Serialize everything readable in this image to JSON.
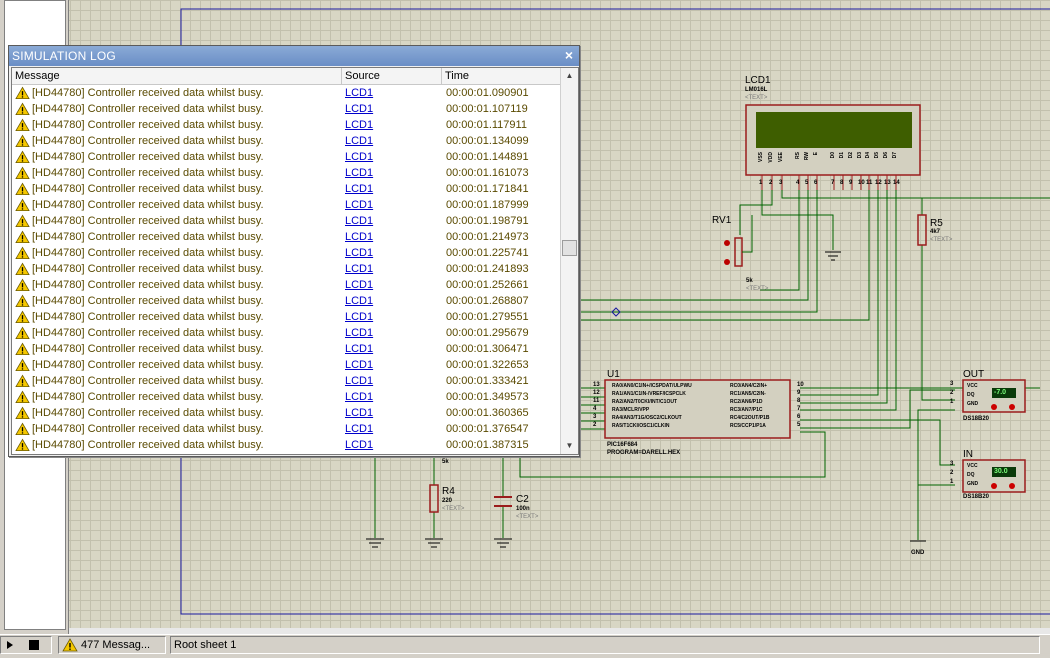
{
  "log_window": {
    "title": "SIMULATION LOG",
    "close_glyph": "×",
    "columns": {
      "message": "Message",
      "source": "Source",
      "time": "Time"
    },
    "rows": [
      {
        "message": "[HD44780] Controller received data whilst busy.",
        "source": "LCD1",
        "time": "00:00:01.090901"
      },
      {
        "message": "[HD44780] Controller received data whilst busy.",
        "source": "LCD1",
        "time": "00:00:01.107119"
      },
      {
        "message": "[HD44780] Controller received data whilst busy.",
        "source": "LCD1",
        "time": "00:00:01.117911"
      },
      {
        "message": "[HD44780] Controller received data whilst busy.",
        "source": "LCD1",
        "time": "00:00:01.134099"
      },
      {
        "message": "[HD44780] Controller received data whilst busy.",
        "source": "LCD1",
        "time": "00:00:01.144891"
      },
      {
        "message": "[HD44780] Controller received data whilst busy.",
        "source": "LCD1",
        "time": "00:00:01.161073"
      },
      {
        "message": "[HD44780] Controller received data whilst busy.",
        "source": "LCD1",
        "time": "00:00:01.171841"
      },
      {
        "message": "[HD44780] Controller received data whilst busy.",
        "source": "LCD1",
        "time": "00:00:01.187999"
      },
      {
        "message": "[HD44780] Controller received data whilst busy.",
        "source": "LCD1",
        "time": "00:00:01.198791"
      },
      {
        "message": "[HD44780] Controller received data whilst busy.",
        "source": "LCD1",
        "time": "00:00:01.214973"
      },
      {
        "message": "[HD44780] Controller received data whilst busy.",
        "source": "LCD1",
        "time": "00:00:01.225741"
      },
      {
        "message": "[HD44780] Controller received data whilst busy.",
        "source": "LCD1",
        "time": "00:00:01.241893"
      },
      {
        "message": "[HD44780] Controller received data whilst busy.",
        "source": "LCD1",
        "time": "00:00:01.252661"
      },
      {
        "message": "[HD44780] Controller received data whilst busy.",
        "source": "LCD1",
        "time": "00:00:01.268807"
      },
      {
        "message": "[HD44780] Controller received data whilst busy.",
        "source": "LCD1",
        "time": "00:00:01.279551"
      },
      {
        "message": "[HD44780] Controller received data whilst busy.",
        "source": "LCD1",
        "time": "00:00:01.295679"
      },
      {
        "message": "[HD44780] Controller received data whilst busy.",
        "source": "LCD1",
        "time": "00:00:01.306471"
      },
      {
        "message": "[HD44780] Controller received data whilst busy.",
        "source": "LCD1",
        "time": "00:00:01.322653"
      },
      {
        "message": "[HD44780] Controller received data whilst busy.",
        "source": "LCD1",
        "time": "00:00:01.333421"
      },
      {
        "message": "[HD44780] Controller received data whilst busy.",
        "source": "LCD1",
        "time": "00:00:01.349573"
      },
      {
        "message": "[HD44780] Controller received data whilst busy.",
        "source": "LCD1",
        "time": "00:00:01.360365"
      },
      {
        "message": "[HD44780] Controller received data whilst busy.",
        "source": "LCD1",
        "time": "00:00:01.376547"
      },
      {
        "message": "[HD44780] Controller received data whilst busy.",
        "source": "LCD1",
        "time": "00:00:01.387315"
      }
    ],
    "icon": "warning-icon"
  },
  "schematic": {
    "lcd": {
      "ref": "LCD1",
      "model": "LM016L",
      "text": "<TEXT>",
      "pins": [
        "VSS",
        "VDD",
        "VEE",
        "RS",
        "RW",
        "E",
        "D0",
        "D1",
        "D2",
        "D3",
        "D4",
        "D5",
        "D6",
        "D7"
      ],
      "pin_numbers": [
        "1",
        "2",
        "3",
        "4",
        "5",
        "6",
        "7",
        "8",
        "9",
        "10",
        "11",
        "12",
        "13",
        "14"
      ]
    },
    "rv1": {
      "ref": "RV1",
      "value": "5k",
      "text": "<TEXT>"
    },
    "r5": {
      "ref": "R5",
      "value": "4k7",
      "text": "<TEXT>"
    },
    "u1": {
      "ref": "U1",
      "model": "PIC16F684",
      "program": "PROGRAM=DARELL.HEX",
      "left_pins": [
        {
          "num": "13",
          "name": "RA0/AN0/C1IN+/ICSPDAT/ULPWU"
        },
        {
          "num": "12",
          "name": "RA1/AN1/C1IN-/VREF/ICSPCLK"
        },
        {
          "num": "11",
          "name": "RA2/AN2/T0CKI/INT/C1OUT"
        },
        {
          "num": "4",
          "name": "RA3/MCLR/VPP"
        },
        {
          "num": "3",
          "name": "RA4/AN3/T1G/OSC2/CLKOUT"
        },
        {
          "num": "2",
          "name": "RA5/T1CKI/OSC1/CLKIN"
        }
      ],
      "right_pins": [
        {
          "num": "10",
          "name": "RC0/AN4/C2IN+"
        },
        {
          "num": "9",
          "name": "RC1/AN5/C2IN-"
        },
        {
          "num": "8",
          "name": "RC2/AN6/P1D"
        },
        {
          "num": "7",
          "name": "RC3/AN7/P1C"
        },
        {
          "num": "6",
          "name": "RC4/C2OUT/P1B"
        },
        {
          "num": "5",
          "name": "RC5/CCP1/P1A"
        }
      ]
    },
    "r4": {
      "ref": "R4",
      "value": "220",
      "text": "<TEXT>",
      "above_value": "5k"
    },
    "c2": {
      "ref": "C2",
      "value": "100n",
      "text": "<TEXT>"
    },
    "sensor_out": {
      "label": "OUT",
      "model": "DS18B20",
      "pins": [
        "VCC",
        "DQ",
        "GND"
      ],
      "nums": [
        "3",
        "2",
        "1"
      ],
      "reading": "-7.0"
    },
    "sensor_in": {
      "label": "IN",
      "model": "DS18B20",
      "pins": [
        "VCC",
        "DQ",
        "GND"
      ],
      "nums": [
        "3",
        "2",
        "1"
      ],
      "reading": "30.0"
    },
    "gnd_label": "GND"
  },
  "status_bar": {
    "messages": "477 Messag...",
    "sheet": "Root sheet 1"
  },
  "colors": {
    "wire": "#006400",
    "component": "#9b1c1c",
    "lcd_screen": "#3e5e00",
    "log_text": "#5a4a00",
    "link": "#0000cc"
  }
}
